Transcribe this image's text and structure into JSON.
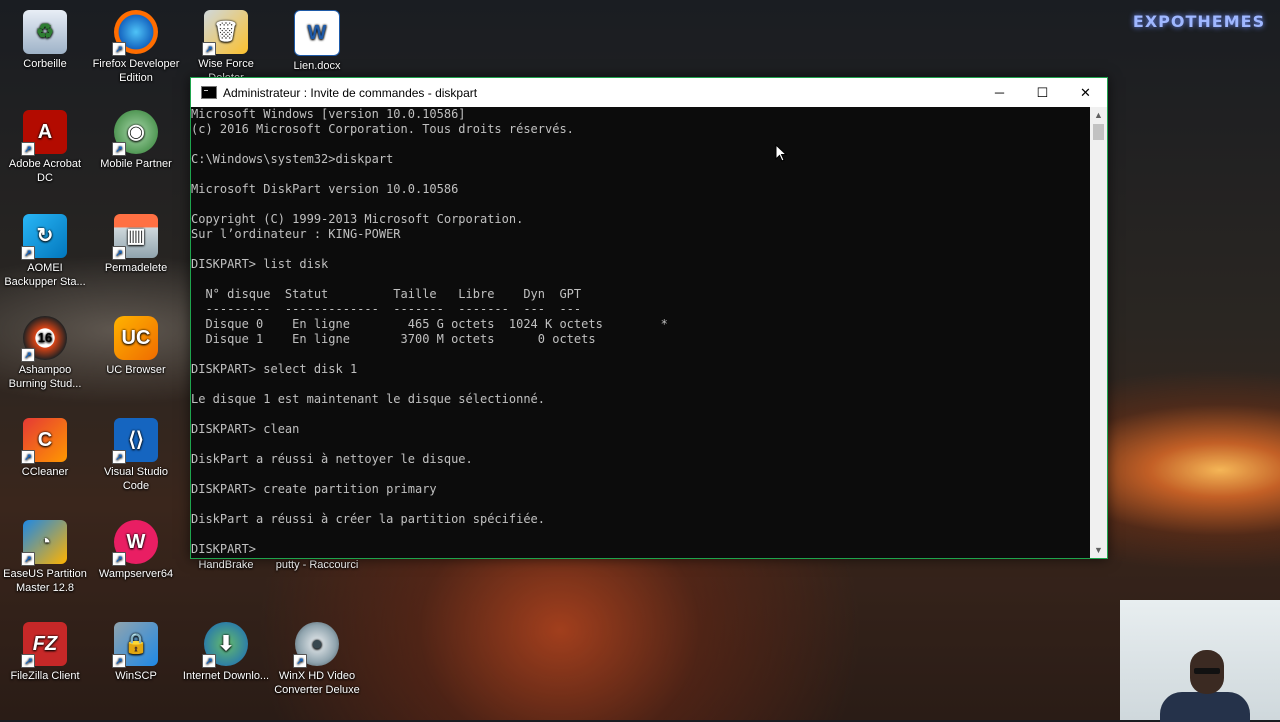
{
  "desktop": {
    "brand_logo": "EXPOTHEMES",
    "icons": [
      {
        "label": "Corbeille",
        "icon": "recycle-bin-icon"
      },
      {
        "label": "Firefox Developer Edition",
        "icon": "firefox-icon"
      },
      {
        "label": "Wise Force Deleter",
        "icon": "wise-force-deleter-icon"
      },
      {
        "label": "Lien.docx",
        "icon": "word-document-icon"
      },
      {
        "label": "Adobe Acrobat DC",
        "icon": "acrobat-icon"
      },
      {
        "label": "Mobile Partner",
        "icon": "mobile-partner-icon"
      },
      {
        "label": "AOMEI Backupper Sta...",
        "icon": "aomei-backupper-icon"
      },
      {
        "label": "Permadelete",
        "icon": "permadelete-icon"
      },
      {
        "label": "Ashampoo Burning Stud...",
        "icon": "ashampoo-icon"
      },
      {
        "label": "UC Browser",
        "icon": "uc-browser-icon"
      },
      {
        "label": "CCleaner",
        "icon": "ccleaner-icon"
      },
      {
        "label": "Visual Studio Code",
        "icon": "vscode-icon"
      },
      {
        "label": "EaseUS Partition Master 12.8",
        "icon": "easeus-icon"
      },
      {
        "label": "Wampserver64",
        "icon": "wampserver-icon"
      },
      {
        "label": "HandBrake",
        "icon": "handbrake-icon"
      },
      {
        "label": "putty - Raccourci",
        "icon": "putty-icon"
      },
      {
        "label": "FileZilla Client",
        "icon": "filezilla-icon"
      },
      {
        "label": "WinSCP",
        "icon": "winscp-icon"
      },
      {
        "label": "Internet Downlo...",
        "icon": "idm-icon"
      },
      {
        "label": "WinX HD Video Converter Deluxe",
        "icon": "winx-video-icon"
      }
    ]
  },
  "window": {
    "title": "Administrateur : Invite de commandes - diskpart",
    "minimize_symbol": "─",
    "maximize_symbol": "☐",
    "close_symbol": "✕",
    "scroll_up_symbol": "▲",
    "scroll_down_symbol": "▼",
    "console_lines": [
      "Microsoft Windows [version 10.0.10586]",
      "(c) 2016 Microsoft Corporation. Tous droits réservés.",
      "",
      "C:\\Windows\\system32>diskpart",
      "",
      "Microsoft DiskPart version 10.0.10586",
      "",
      "Copyright (C) 1999-2013 Microsoft Corporation.",
      "Sur l’ordinateur : KING-POWER",
      "",
      "DISKPART> list disk",
      "",
      "  N° disque  Statut         Taille   Libre    Dyn  GPT",
      "  ---------  -------------  -------  -------  ---  ---",
      "  Disque 0    En ligne        465 G octets  1024 K octets        *",
      "  Disque 1    En ligne       3700 M octets      0 octets",
      "",
      "DISKPART> select disk 1",
      "",
      "Le disque 1 est maintenant le disque sélectionné.",
      "",
      "DISKPART> clean",
      "",
      "DiskPart a réussi à nettoyer le disque.",
      "",
      "DISKPART> create partition primary",
      "",
      "DiskPart a réussi à créer la partition spécifiée.",
      "",
      "DISKPART> "
    ]
  },
  "colors": {
    "window_border": "#1ea44d",
    "console_bg": "#0c0c0c",
    "console_text": "#c0c0c0"
  }
}
